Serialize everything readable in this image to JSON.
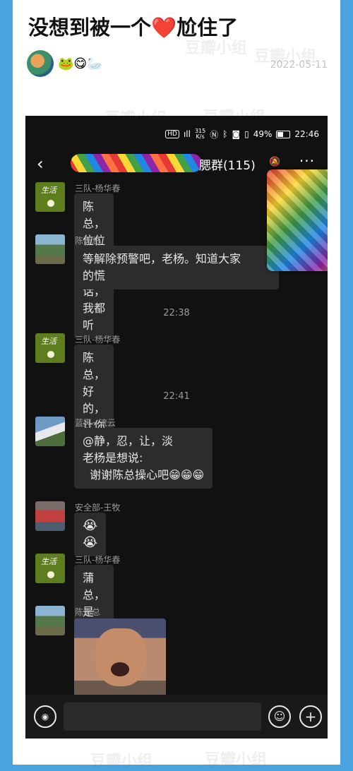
{
  "post": {
    "title_before": "没想到被一个",
    "title_heart": "❤️",
    "title_after": "尬住了",
    "author_emoji": "🐸😋🦢",
    "date": "2022-05-11"
  },
  "watermark": "豆瓣小组",
  "statusbar": {
    "hd": "HD",
    "signal": "ıll",
    "speed_value": "315",
    "speed_unit": "K/s",
    "battery": "49%",
    "time": "22:46"
  },
  "chat": {
    "back_icon": "‹",
    "group_title": "腮群(115)",
    "more_icon": "···",
    "messages": [
      {
        "sender": "三队-杨华春",
        "text": "陈总，位位领导说话，我都听"
      },
      {
        "sender": "陈勇总",
        "text": "等解除预警吧，老杨。知道大家\n的慌"
      },
      {
        "timestamp": "22:38"
      },
      {
        "sender": "三队-杨华春",
        "text": "陈总，好的，让你操❤️"
      },
      {
        "timestamp": "22:41"
      },
      {
        "sender": "蓝天~流云",
        "text": "@静，忍，让，淡\n老杨是想说:\n  谢谢陈总操心吧😁😁😁"
      },
      {
        "sender": "安全部-王牧",
        "text": "😭😭"
      },
      {
        "sender": "三队-杨华春",
        "text": "蒲总，是的，谢谢陈总操心了"
      },
      {
        "sender": "陈勇总"
      }
    ]
  },
  "icons": {
    "voice": "voice-icon",
    "emoji": "emoji-icon",
    "plus": "plus-icon",
    "mute": "mute-icon"
  },
  "colors": {
    "background": "#4aa3df",
    "chat_bg": "#111111",
    "bubble": "#2c2c2c"
  }
}
